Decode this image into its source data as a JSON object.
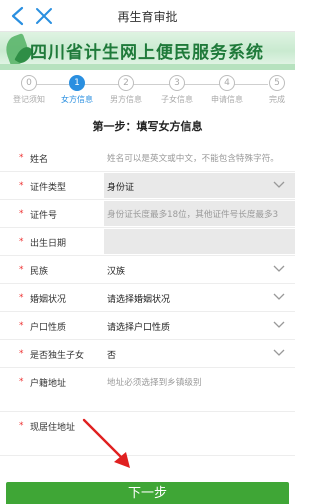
{
  "topbar": {
    "title": "再生育审批"
  },
  "banner": {
    "text": "四川省计生网上便民服务系统"
  },
  "steps": [
    {
      "num": "0",
      "label": "登记须知",
      "active": false
    },
    {
      "num": "1",
      "label": "女方信息",
      "active": true
    },
    {
      "num": "2",
      "label": "男方信息",
      "active": false
    },
    {
      "num": "3",
      "label": "子女信息",
      "active": false
    },
    {
      "num": "4",
      "label": "申请信息",
      "active": false
    },
    {
      "num": "5",
      "label": "完成",
      "active": false
    }
  ],
  "section_title": "第一步：填写女方信息",
  "form": {
    "name": {
      "label": "姓名",
      "placeholder": "姓名可以是英文或中文，不能包含特殊字符。"
    },
    "id_type": {
      "label": "证件类型",
      "value": "身份证"
    },
    "id_number": {
      "label": "证件号",
      "placeholder": "身份证长度最多18位，其他证件号长度最多3"
    },
    "birth_date": {
      "label": "出生日期",
      "value": ""
    },
    "ethnicity": {
      "label": "民族",
      "value": "汉族"
    },
    "marital_status": {
      "label": "婚姻状况",
      "value": "请选择婚姻状况"
    },
    "household_type": {
      "label": "户口性质",
      "value": "请选择户口性质"
    },
    "only_child": {
      "label": "是否独生子女",
      "value": "否"
    },
    "household_address": {
      "label": "户籍地址",
      "placeholder": "地址必须选择到乡镇级别"
    },
    "current_address": {
      "label": "现居住地址",
      "placeholder": ""
    }
  },
  "required_mark": "*",
  "next_button": {
    "label": "下一步"
  },
  "colors": {
    "accent": "#2a8fe0",
    "button": "#3fa636",
    "required": "#e33333",
    "arrow": "#e02020"
  }
}
